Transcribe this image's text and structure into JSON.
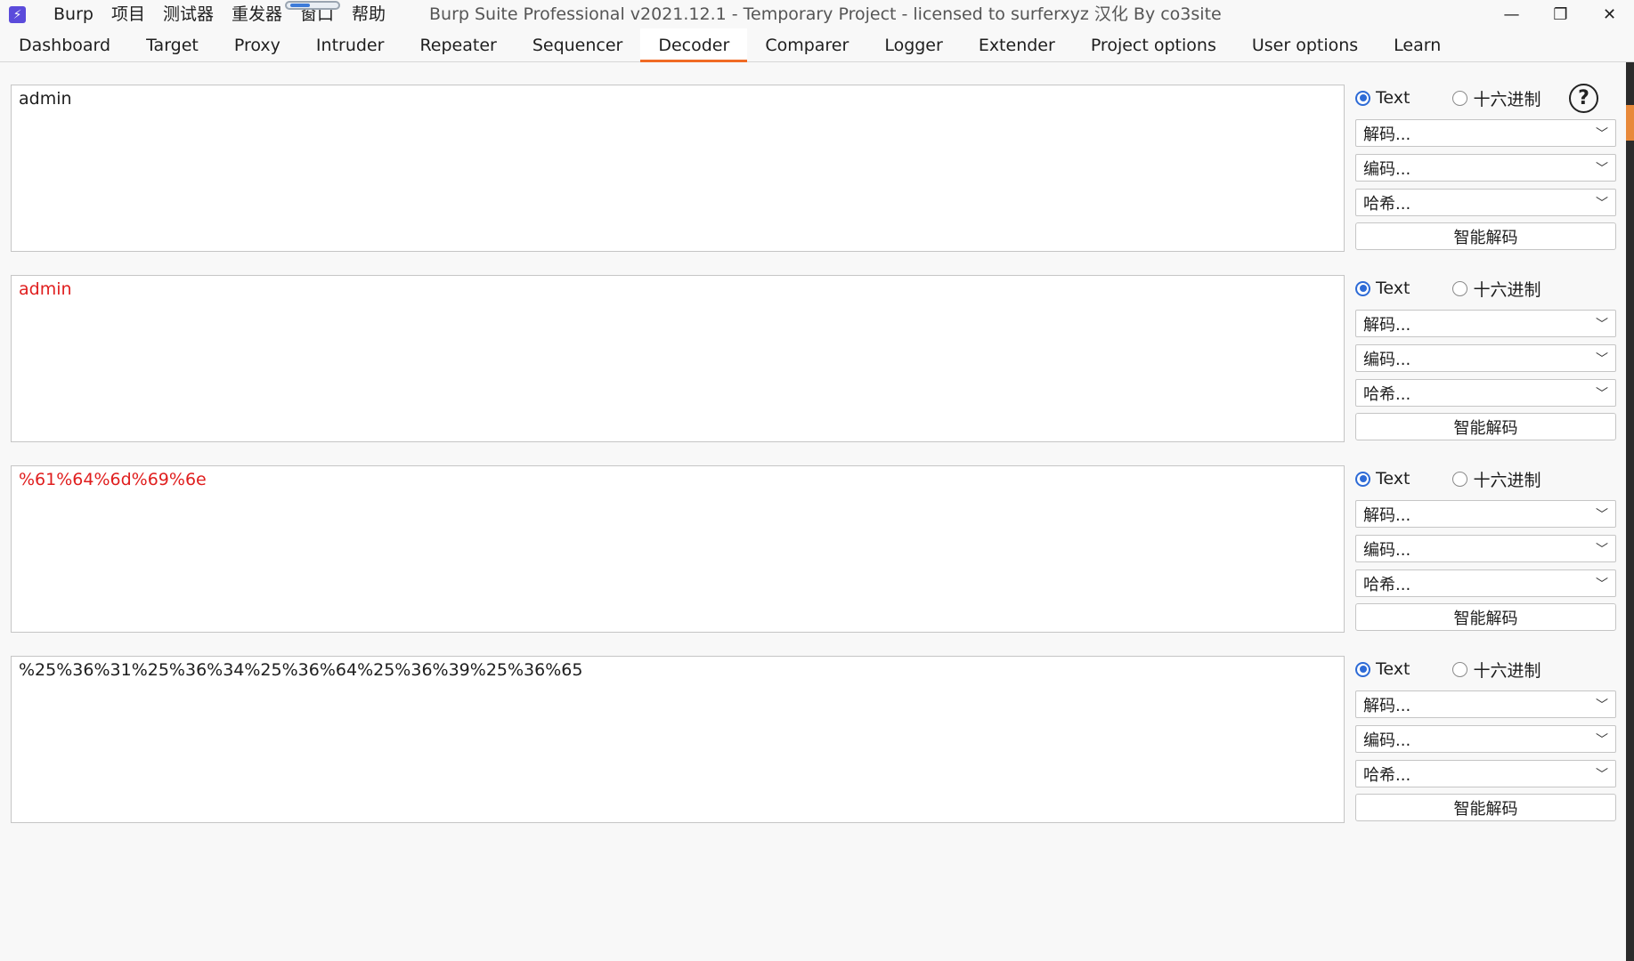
{
  "titlebar": {
    "app_icon_glyph": "⚡",
    "menu": [
      "Burp",
      "项目",
      "测试器",
      "重发器",
      "窗口",
      "帮助"
    ],
    "title": "Burp Suite Professional v2021.12.1 - Temporary Project - licensed to surferxyz 汉化 By co3site",
    "controls": {
      "minimize": "—",
      "restore": "❐",
      "close": "✕"
    }
  },
  "tabs": [
    {
      "label": "Dashboard"
    },
    {
      "label": "Target"
    },
    {
      "label": "Proxy"
    },
    {
      "label": "Intruder"
    },
    {
      "label": "Repeater"
    },
    {
      "label": "Sequencer"
    },
    {
      "label": "Decoder",
      "active": true
    },
    {
      "label": "Comparer"
    },
    {
      "label": "Logger"
    },
    {
      "label": "Extender"
    },
    {
      "label": "Project options"
    },
    {
      "label": "User options"
    },
    {
      "label": "Learn"
    }
  ],
  "controls_labels": {
    "text": "Text",
    "hex": "十六进制",
    "decode": "解码...",
    "encode": "编码...",
    "hash": "哈希...",
    "smart_decode": "智能解码",
    "help": "?"
  },
  "panels": [
    {
      "text": "admin",
      "color": "#1e1e1e",
      "selected_mode": "Text"
    },
    {
      "text": "admin",
      "color": "#e01e1e",
      "selected_mode": "Text"
    },
    {
      "text": "%61%64%6d%69%6e",
      "color": "#e01e1e",
      "selected_mode": "Text"
    },
    {
      "text": "%25%36%31%25%36%34%25%36%64%25%36%39%25%36%65",
      "color": "#1e1e1e",
      "selected_mode": "Text"
    }
  ],
  "colors": {
    "accent_tab": "#f06b25",
    "radio_selected": "#2e6bd6",
    "output_text_red": "#e01e1e"
  }
}
